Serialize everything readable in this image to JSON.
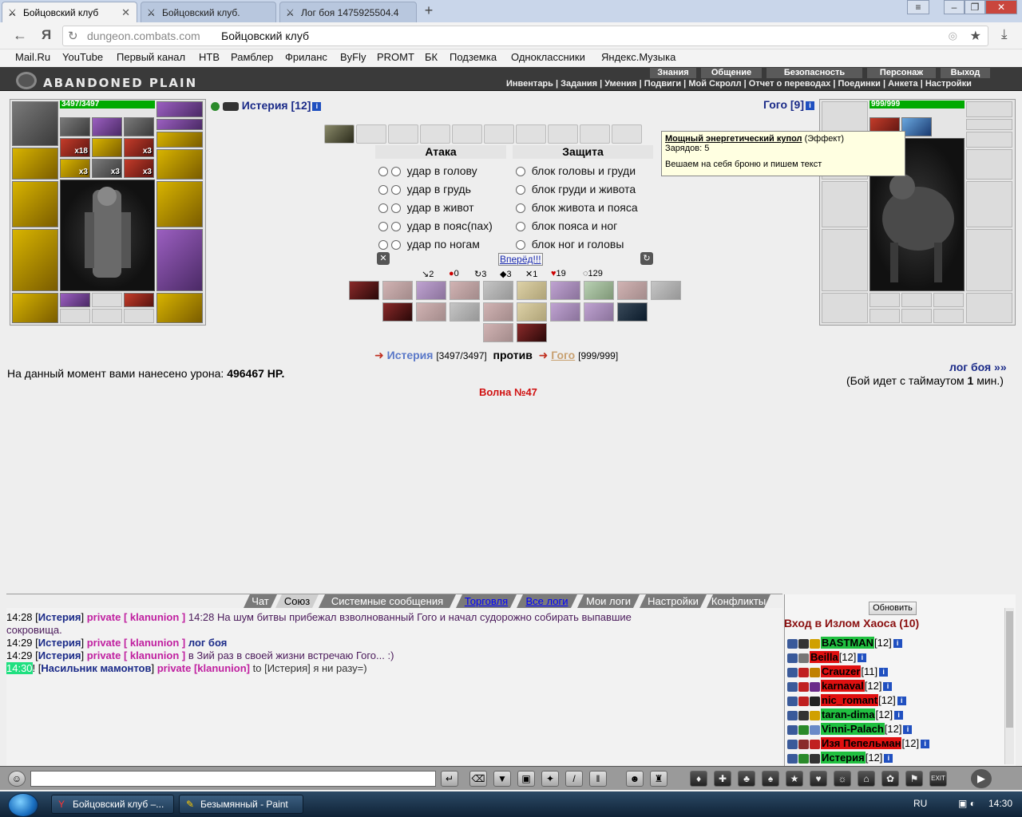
{
  "browser": {
    "tabs": [
      {
        "title": "Бойцовский клуб",
        "icon": "swords-icon",
        "active": true
      },
      {
        "title": "Бойцовский клуб.",
        "icon": "swords-icon",
        "active": false
      },
      {
        "title": "Лог боя 1475925504.4",
        "icon": "swords-icon",
        "active": false
      }
    ],
    "new_tab": "+",
    "window_buttons": {
      "menu": "≡",
      "minimize": "–",
      "restore": "❐",
      "close": "✕"
    },
    "address": {
      "host": "dungeon.combats.com",
      "title": "Бойцовский клуб"
    },
    "bookmarks": [
      "Mail.Ru",
      "YouTube",
      "Первый канал",
      "НТВ",
      "Рамблер",
      "Фриланс",
      "ByFly",
      "PROMT",
      "БК",
      "Подземка",
      "Одноклассники",
      "Яндекс.Музыка"
    ]
  },
  "game_header": {
    "logo": "ABANDONED PLAIN",
    "top_menu": [
      "Знания",
      "Общение",
      "Безопасность",
      "Персонаж",
      "Выход"
    ],
    "sub_menu": "Инвентарь | Задания | Умения | Подвиги | Мой Скролл | Отчет о переводах | Поединки | Анкета | Настройки"
  },
  "player": {
    "name": "Истерия",
    "level": "[12]",
    "hp": "3497/3497",
    "counts": {
      "a": "x18",
      "b": "x3",
      "c": "x3",
      "d": "x3",
      "e": "x3"
    }
  },
  "enemy": {
    "name": "Гого",
    "level": "[9]",
    "hp": "999/999"
  },
  "attack": {
    "title": "Атака",
    "rows": [
      "удар в голову",
      "удар в грудь",
      "удар в живот",
      "удар в пояс(пах)",
      "удар по ногам"
    ]
  },
  "defense": {
    "title": "Защита",
    "rows": [
      "блок головы и груди",
      "блок груди и живота",
      "блок живота и пояса",
      "блок пояса и ног",
      "блок ног и головы"
    ]
  },
  "forward_button": "Вперёд!!!",
  "stats": [
    "2",
    "0",
    "3",
    "3",
    "1",
    "19",
    "129"
  ],
  "tooltip": {
    "title": "Мощный энергетический купол",
    "type": "(Эффект)",
    "charges": "Зарядов: 5",
    "desc": "Вешаем на себя броню и пишем текст"
  },
  "versus": {
    "p1": "Истерия",
    "p1_hp": "[3497/3497]",
    "vs": "против",
    "p2": "Гого",
    "p2_hp": "[999/999]"
  },
  "damage": {
    "label": "На данный момент вами нанесено урона:",
    "value": "496467 HP."
  },
  "wave": "Волна №47",
  "battle_log": {
    "link": "лог боя »»",
    "timeout_pre": "(Бой идет с таймаутом",
    "timeout_val": "1",
    "timeout_post": "мин.)"
  },
  "chat": {
    "tabs": [
      "Чат",
      "Союз",
      "Системные сообщения",
      "Торговля",
      "Все логи",
      "Мои логи",
      "Настройки",
      "Конфликты"
    ],
    "messages": [
      {
        "time": "14:28",
        "nick": "Истерия",
        "priv": "private [ klanunion ]",
        "text": "14:28 На шум битвы прибежал взволнованный Гого и начал судорожно собирать выпавшие",
        "cont": "сокровища."
      },
      {
        "time": "14:29",
        "nick": "Истерия",
        "priv": "private [ klanunion ]",
        "text": "лог боя"
      },
      {
        "time": "14:29",
        "nick": "Истерия",
        "priv": "private [ klanunion ]",
        "text": "в Зий раз в своей жизни встречаю Гого... :)"
      },
      {
        "time": "14:30",
        "nick": "Насильник мамонтов",
        "priv": "private [klanunion]",
        "text": "to [Истерия] я ни разу=)"
      }
    ]
  },
  "players_panel": {
    "refresh": "Обновить",
    "title": "Вход в Излом Хаоса (10)",
    "players": [
      {
        "name": "BASTMAN",
        "level": "[12]",
        "color": "g"
      },
      {
        "name": "Beilla",
        "level": "[12]",
        "color": "r"
      },
      {
        "name": "Crauzer",
        "level": "[11]",
        "color": "r"
      },
      {
        "name": "karnaval",
        "level": "[12]",
        "color": "r"
      },
      {
        "name": "nic_romant",
        "level": "[12]",
        "color": "r"
      },
      {
        "name": "taran-dima",
        "level": "[12]",
        "color": "g"
      },
      {
        "name": "Vinni-Palach",
        "level": "[12]",
        "color": "g"
      },
      {
        "name": "Изя Пепельман",
        "level": "[12]",
        "color": "r"
      },
      {
        "name": "Истерия",
        "level": "[12]",
        "color": "g"
      }
    ]
  },
  "toolbar": {
    "exit": "EXIT"
  },
  "taskbar": {
    "tasks": [
      "Бойцовский клуб –...",
      "Безымянный - Paint"
    ],
    "lang": "RU",
    "clock": "14:30"
  }
}
